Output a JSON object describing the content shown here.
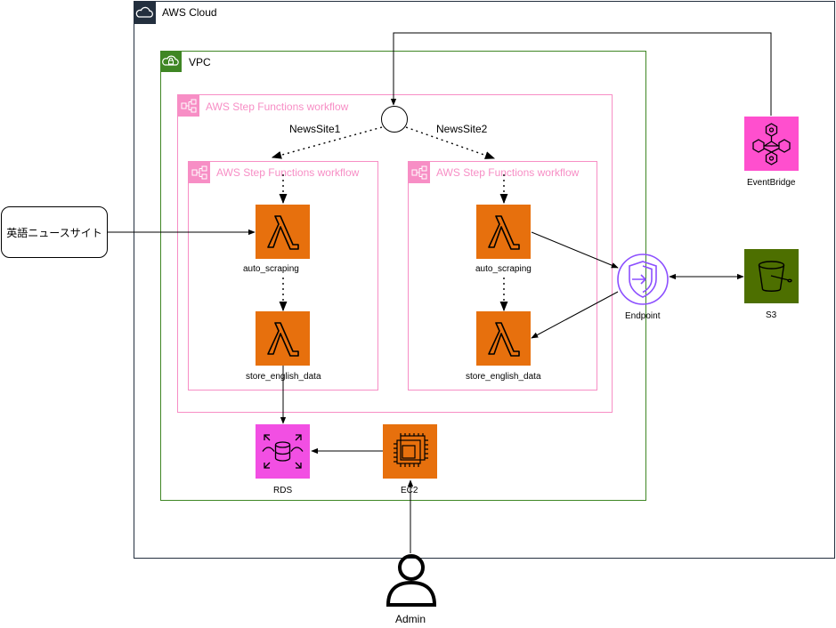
{
  "groups": {
    "aws_cloud": "AWS Cloud",
    "vpc": "VPC",
    "sfn_outer": "AWS Step Functions workflow",
    "sfn_left": "AWS Step Functions workflow",
    "sfn_right": "AWS Step Functions workflow"
  },
  "branches": {
    "left": "NewsSite1",
    "right": "NewsSite2"
  },
  "nodes": {
    "external_site": "英語ニュースサイト",
    "lambda_scrape_left": "auto_scraping",
    "lambda_store_left": "store_english_data",
    "lambda_scrape_right": "auto_scraping",
    "lambda_store_right": "store_english_data",
    "rds": "RDS",
    "ec2": "EC2",
    "endpoint": "Endpoint",
    "s3": "S3",
    "eventbridge": "EventBridge",
    "admin": "Admin"
  },
  "icons": {
    "aws_cloud": "cloud-icon",
    "vpc": "cloud-lock-icon",
    "step_functions": "step-functions-icon",
    "lambda": "lambda-icon",
    "rds": "rds-icon",
    "ec2": "ec2-chip-icon",
    "endpoint": "vpc-endpoint-icon",
    "s3": "s3-bucket-icon",
    "eventbridge": "eventbridge-icon",
    "admin": "user-icon"
  },
  "colors": {
    "cloud_border": "#232f3e",
    "vpc_border": "#3f8624",
    "sfn_border": "#f78ec5",
    "lambda": "#e7700d",
    "ec2": "#e7700d",
    "rds": "#f24fe3",
    "eventbridge": "#ff4fce",
    "s3": "#4d6f00",
    "endpoint": "#8c4fff"
  }
}
